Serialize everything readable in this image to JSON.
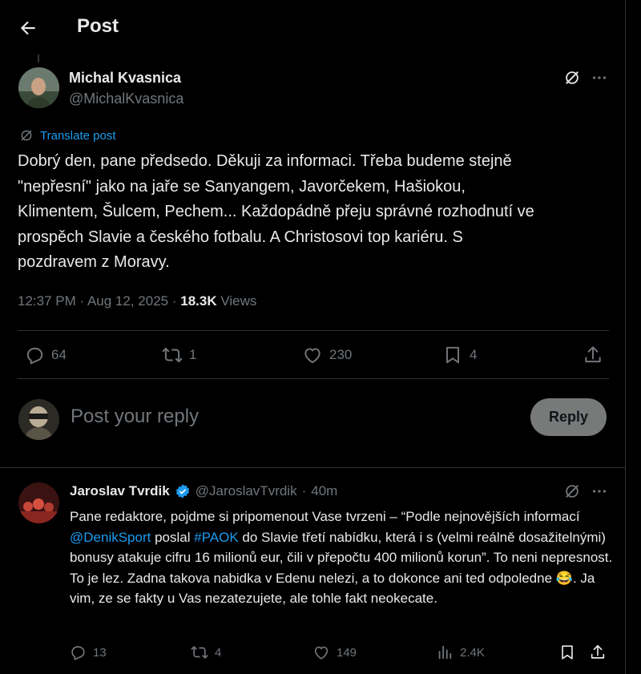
{
  "header": {
    "title": "Post"
  },
  "post": {
    "author_name": "Michal Kvasnica",
    "author_handle": "@MichalKvasnica",
    "translate_label": "Translate post",
    "text_lines": [
      "Dobrý den, pane předsedo. Děkuji za informaci. Třeba budeme stejně",
      "\"nepřesní\" jako na jaře se Sanyangem, Javorčekem, Hašiokou,",
      "Klimentem, Šulcem, Pechem... Každopádně přeju správné rozhodnutí ve",
      "prospěch Slavie a českého fotbalu. A Christosovi top kariéru. S",
      "pozdravem z Moravy."
    ],
    "time": "12:37 PM",
    "date": "Aug 12, 2025",
    "views_count": "18.3K",
    "views_label": "Views",
    "replies": "64",
    "reposts": "1",
    "likes": "230",
    "bookmarks": "4"
  },
  "composer": {
    "placeholder": "Post your reply",
    "reply_button": "Reply"
  },
  "reply": {
    "author_name": "Jaroslav Tvrdik",
    "author_handle": "@JaroslavTvrdik",
    "time_ago": "40m",
    "seg1": "Pane redaktore, pojdme si pripomenout Vase tvrzeni – “Podle nejnovějších informací ",
    "mention": "@DenikSport",
    "seg2": " poslal ",
    "hashtag": "#PAOK",
    "seg3": " do Slavie třetí nabídku, která i s (velmi reálně dosažitelnými) bonusy atakuje cifru 16 milionů eur, čili v přepočtu 400 milionů korun”.  To neni nepresnost. To je lez. Zadna takova nabidka v Edenu nelezi, a to dokonce ani ted odpoledne ",
    "emoji": "😂",
    "seg4": ". Ja vim, ze se fakty u Vas nezatezujete, ale tohle fakt neokecate.",
    "replies": "13",
    "reposts": "4",
    "likes": "149",
    "views": "2.4K"
  }
}
